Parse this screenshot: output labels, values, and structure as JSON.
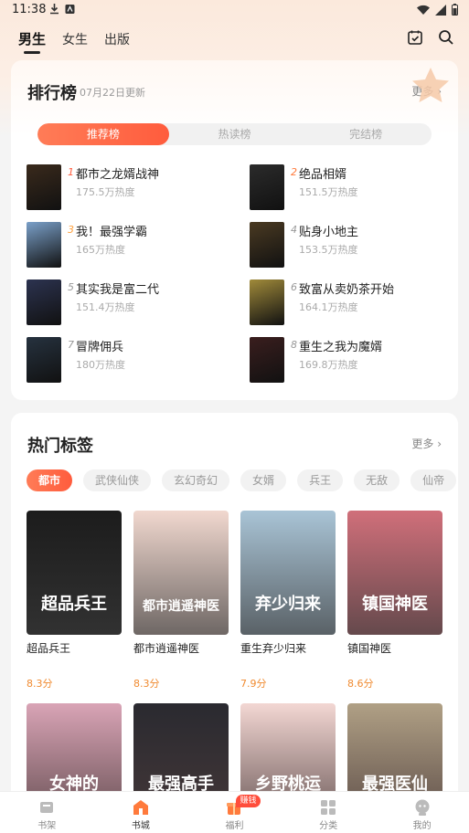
{
  "status_bar": {
    "time": "11:38"
  },
  "header": {
    "tabs": [
      {
        "label": "男生",
        "active": true
      },
      {
        "label": "女生",
        "active": false
      },
      {
        "label": "出版",
        "active": false
      }
    ],
    "icons": [
      "checkin-icon",
      "search-icon"
    ]
  },
  "ranking": {
    "title": "排行榜",
    "updated": "07月22日更新",
    "more": "更多",
    "tabs": [
      {
        "label": "推荐榜",
        "active": true
      },
      {
        "label": "热读榜",
        "active": false
      },
      {
        "label": "完结榜",
        "active": false
      }
    ],
    "items": [
      {
        "rank": "1",
        "title": "都市之龙婿战神",
        "heat": "175.5万热度",
        "cover": "#3a2a1c"
      },
      {
        "rank": "2",
        "title": "绝品相婿",
        "heat": "151.5万热度",
        "cover": "#2b2b2b"
      },
      {
        "rank": "3",
        "title": "我！最强学霸",
        "heat": "165万热度",
        "cover": "#7aa0c9"
      },
      {
        "rank": "4",
        "title": "贴身小地主",
        "heat": "153.5万热度",
        "cover": "#4a3a22"
      },
      {
        "rank": "5",
        "title": "其实我是富二代",
        "heat": "151.4万热度",
        "cover": "#2c3350"
      },
      {
        "rank": "6",
        "title": "致富从卖奶茶开始",
        "heat": "164.1万热度",
        "cover": "#a08a3a"
      },
      {
        "rank": "7",
        "title": "冒牌佣兵",
        "heat": "180万热度",
        "cover": "#26323f"
      },
      {
        "rank": "8",
        "title": "重生之我为魔婿",
        "heat": "169.8万热度",
        "cover": "#3a1e1e"
      }
    ],
    "rank_colors": [
      "#ff5a3c",
      "#ff7a3c",
      "#ffa03c",
      "#999999",
      "#999999",
      "#999999",
      "#999999",
      "#999999"
    ]
  },
  "tags": {
    "title": "热门标签",
    "more": "更多",
    "chips": [
      {
        "label": "都市",
        "active": true
      },
      {
        "label": "武侠仙侠",
        "active": false
      },
      {
        "label": "玄幻奇幻",
        "active": false
      },
      {
        "label": "女婿",
        "active": false
      },
      {
        "label": "兵王",
        "active": false
      },
      {
        "label": "无敌",
        "active": false
      },
      {
        "label": "仙帝",
        "active": false
      }
    ],
    "books": [
      {
        "title": "超品兵王",
        "score": "8.3分",
        "cover_text": "超品兵王",
        "cover_color": "#1c1c1c"
      },
      {
        "title": "都市逍遥神医",
        "score": "8.3分",
        "cover_text": "都市逍遥神医",
        "cover_color": "#f1d8cf"
      },
      {
        "title": "重生弃少归来",
        "score": "7.9分",
        "cover_text": "弃少归来",
        "cover_color": "#a9c4d6"
      },
      {
        "title": "镇国神医",
        "score": "8.6分",
        "cover_text": "镇国神医",
        "cover_color": "#d06f7a"
      }
    ],
    "books_row2": [
      {
        "cover_text": "女神的",
        "cover_color": "#d9a4b6"
      },
      {
        "cover_text": "最强高手",
        "cover_color": "#2a2a30"
      },
      {
        "cover_text": "乡野桃运",
        "cover_color": "#f3d7d3"
      },
      {
        "cover_text": "最强医仙",
        "cover_color": "#b0a085"
      }
    ]
  },
  "bottom_nav": [
    {
      "label": "书架",
      "icon": "bookshelf-icon",
      "active": false
    },
    {
      "label": "书城",
      "icon": "bookstore-icon",
      "active": true
    },
    {
      "label": "福利",
      "icon": "gift-icon",
      "active": false,
      "badge": "赚钱"
    },
    {
      "label": "分类",
      "icon": "category-icon",
      "active": false
    },
    {
      "label": "我的",
      "icon": "profile-icon",
      "active": false
    }
  ]
}
